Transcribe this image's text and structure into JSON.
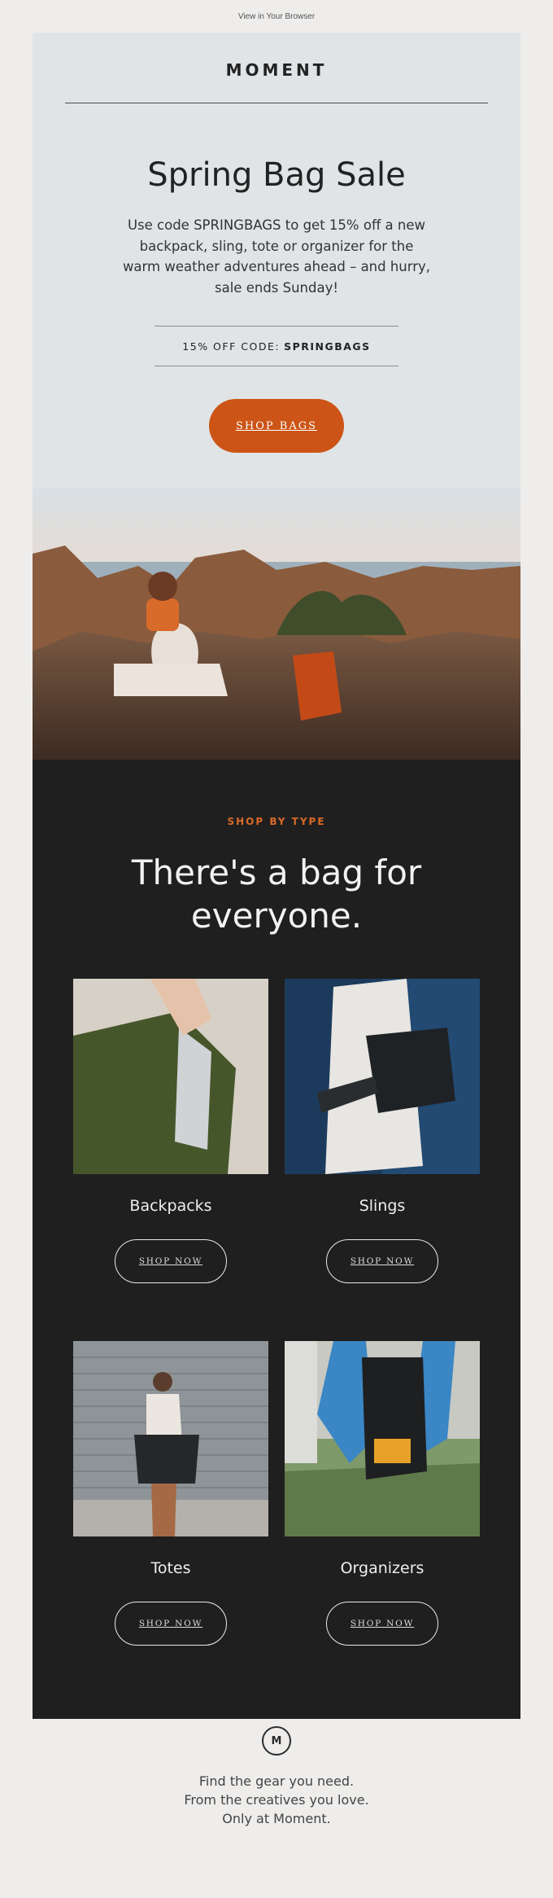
{
  "topbar": {
    "browser_link": "View in Your Browser"
  },
  "header": {
    "logo_text": "MOMENT"
  },
  "hero": {
    "title": "Spring Bag Sale",
    "body": "Use code SPRINGBAGS to get 15% off a new backpack, sling, tote or organizer for the warm weather adventures ahead – and hurry, sale ends Sunday!",
    "code_label": "15% OFF CODE:",
    "code_value": "SPRINGBAGS",
    "cta_label": "SHOP BAGS"
  },
  "shop_by_type": {
    "eyebrow": "SHOP BY TYPE",
    "title": "There's a bag for everyone.",
    "cards": [
      {
        "label": "Backpacks",
        "button": "SHOP NOW"
      },
      {
        "label": "Slings",
        "button": "SHOP NOW"
      },
      {
        "label": "Totes",
        "button": "SHOP NOW"
      },
      {
        "label": "Organizers",
        "button": "SHOP NOW"
      }
    ]
  },
  "footer": {
    "logo_mark": "M",
    "line1": "Find the gear you need.",
    "line2": "From the creatives you love.",
    "line3": "Only at Moment."
  },
  "colors": {
    "accent": "#cc5416",
    "dark_bg": "#1f1f1f",
    "hero_bg": "#e0e4e6",
    "page_bg": "#eeedec"
  }
}
